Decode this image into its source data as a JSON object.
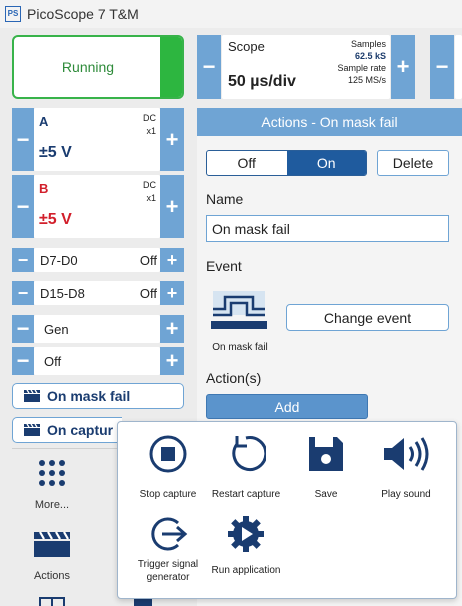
{
  "app": {
    "logo_text": "PS",
    "title": "PicoScope 7 T&M"
  },
  "run": {
    "label": "Running"
  },
  "scope": {
    "title": "Scope",
    "timebase": "50 µs/div",
    "samples_label": "Samples",
    "samples_value": "62.5 kS",
    "rate_label": "Sample rate",
    "rate_value": "125 MS/s"
  },
  "channels": [
    {
      "letter": "A",
      "coupling": "DC",
      "probe": "x1",
      "range": "±5 V",
      "color": "#1a3c70"
    },
    {
      "letter": "B",
      "coupling": "DC",
      "probe": "x1",
      "range": "±5 V",
      "color": "#d21f2b"
    }
  ],
  "digital": [
    {
      "label": "D7-D0",
      "state": "Off"
    },
    {
      "label": "D15-D8",
      "state": "Off"
    }
  ],
  "generator": {
    "label": "Gen",
    "state": "Off"
  },
  "buttons": {
    "minus": "−",
    "plus": "+"
  },
  "sidebar": {
    "mask_fail_button": "On mask fail",
    "capture_button": "On captur",
    "more_label": "More...",
    "actions_label": "Actions"
  },
  "actions_panel": {
    "header": "Actions - On mask fail",
    "toggle_off": "Off",
    "toggle_on": "On",
    "delete": "Delete",
    "name_label": "Name",
    "name_value": "On mask fail",
    "event_label": "Event",
    "event_caption": "On mask fail",
    "change_event": "Change event",
    "actions_label": "Action(s)",
    "add": "Add"
  },
  "popup": {
    "items": [
      {
        "label": "Stop capture",
        "icon": "stop-capture-icon"
      },
      {
        "label": "Restart capture",
        "icon": "restart-capture-icon"
      },
      {
        "label": "Save",
        "icon": "save-icon"
      },
      {
        "label": "Play sound",
        "icon": "play-sound-icon"
      },
      {
        "label": "Trigger signal generator",
        "icon": "trigger-signal-generator-icon"
      },
      {
        "label": "Run application",
        "icon": "run-application-icon"
      }
    ]
  },
  "colors": {
    "accent": "#6fa4d4",
    "dark_blue": "#1f5b9e",
    "running_green": "#2db640"
  }
}
